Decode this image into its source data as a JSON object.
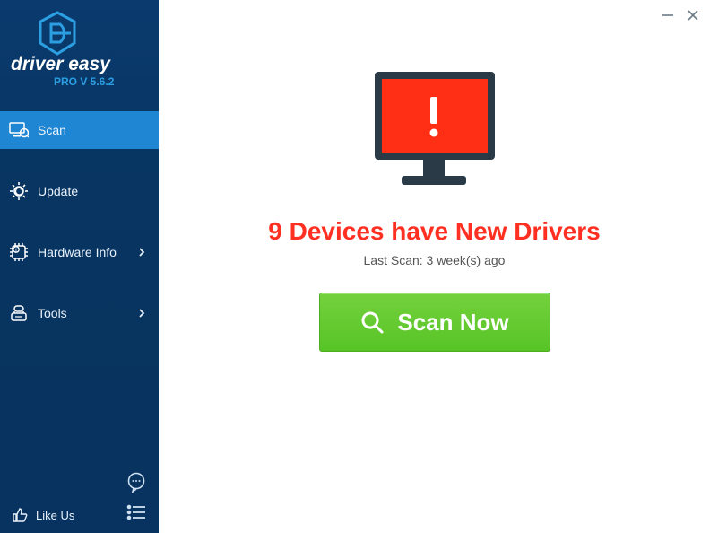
{
  "brand": {
    "name": "driver easy",
    "version": "PRO V 5.6.2"
  },
  "sidebar": {
    "items": [
      {
        "label": "Scan",
        "icon": "scan-icon",
        "active": true
      },
      {
        "label": "Update",
        "icon": "gear-refresh-icon",
        "chevron": false
      },
      {
        "label": "Hardware Info",
        "icon": "hardware-info-icon",
        "chevron": true
      },
      {
        "label": "Tools",
        "icon": "tools-icon",
        "chevron": true
      }
    ],
    "like": {
      "label": "Like Us"
    }
  },
  "main": {
    "headline": "9 Devices have New Drivers",
    "last_scan": "Last Scan: 3 week(s) ago",
    "scan_button": "Scan Now"
  },
  "colors": {
    "accent_blue": "#1e86d3",
    "sidebar_bg": "#083561",
    "alert_red": "#ff2f22",
    "button_green": "#57c426"
  }
}
